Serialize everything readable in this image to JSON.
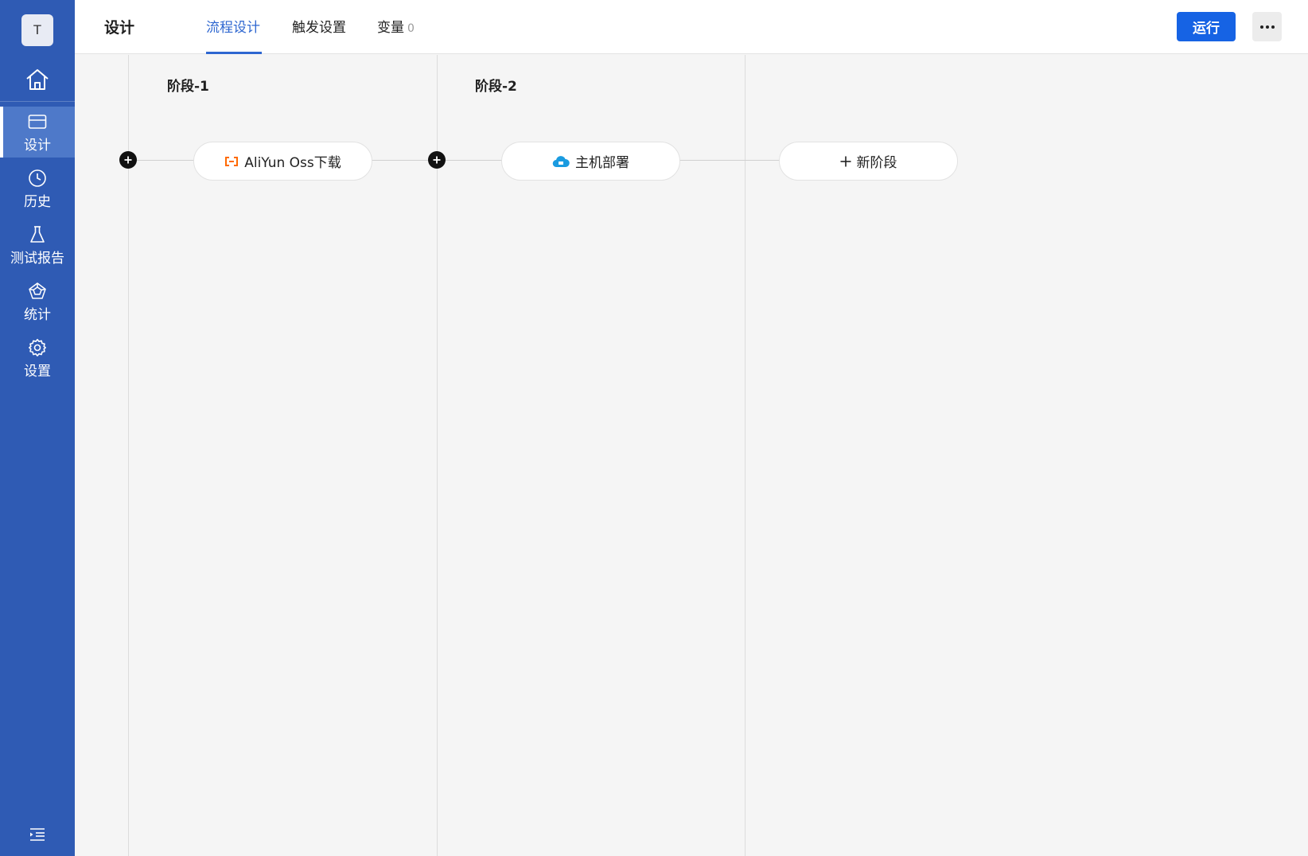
{
  "sidebar": {
    "avatar_letter": "T",
    "items": [
      {
        "label": "设计",
        "icon": "card-icon",
        "active": true
      },
      {
        "label": "历史",
        "icon": "clock-icon",
        "active": false
      },
      {
        "label": "测试报告",
        "icon": "flask-icon",
        "active": false
      },
      {
        "label": "统计",
        "icon": "pentagon-chart-icon",
        "active": false
      },
      {
        "label": "设置",
        "icon": "gear-icon",
        "active": false
      }
    ]
  },
  "header": {
    "title": "设计",
    "tabs": [
      {
        "label": "流程设计",
        "active": true
      },
      {
        "label": "触发设置",
        "active": false
      },
      {
        "label": "变量",
        "count": "0",
        "active": false
      }
    ],
    "run_label": "运行"
  },
  "canvas": {
    "stages": [
      {
        "title": "阶段-1",
        "task": {
          "label": "AliYun Oss下载",
          "icon": "aliyun-oss-icon"
        }
      },
      {
        "title": "阶段-2",
        "task": {
          "label": "主机部署",
          "icon": "cloud-host-icon"
        }
      }
    ],
    "new_stage_label": "新阶段"
  },
  "colors": {
    "sidebar": "#2f5bb4",
    "sidebar_active": "#4e79c9",
    "accent": "#1663e4",
    "aliyun_orange": "#ff6a00",
    "cloud_blue": "#1a9be0"
  }
}
